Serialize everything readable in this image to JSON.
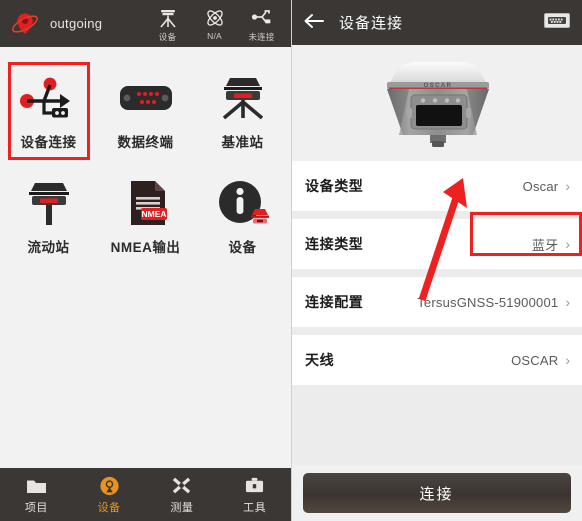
{
  "left": {
    "header": {
      "logo_icon": "red-location-planet-logo",
      "app_name": "outgoing",
      "status": [
        {
          "icon": "antenna-tripod-icon",
          "label": "设备"
        },
        {
          "icon": "satellite-atom-icon",
          "label": "N/A"
        },
        {
          "icon": "usb-plug-icon",
          "label": "未连接"
        }
      ]
    },
    "grid": [
      {
        "icon": "usb-connect-icon",
        "label": "设备连接",
        "selected": true
      },
      {
        "icon": "serial-port-icon",
        "label": "数据终端",
        "selected": false
      },
      {
        "icon": "base-station-icon",
        "label": "基准站",
        "selected": false
      },
      {
        "icon": "rover-station-icon",
        "label": "流动站",
        "selected": false
      },
      {
        "icon": "nmea-file-icon",
        "label": "NMEA输出",
        "selected": false
      },
      {
        "icon": "device-info-icon",
        "label": "设备",
        "selected": false
      }
    ],
    "tabbar": [
      {
        "icon": "folder-icon",
        "label": "项目",
        "active": false
      },
      {
        "icon": "device-radar-icon",
        "label": "设备",
        "active": true
      },
      {
        "icon": "survey-cross-icon",
        "label": "测量",
        "active": false
      },
      {
        "icon": "toolbox-icon",
        "label": "工具",
        "active": false
      }
    ],
    "highlight_color": "#ee2020"
  },
  "right": {
    "header": {
      "back_icon": "back-arrow-icon",
      "title": "设备连接",
      "right_icon": "serial-connector-icon"
    },
    "device_image": {
      "icon": "gnss-receiver-image",
      "brand_text": "OSCAR"
    },
    "rows": [
      {
        "label": "设备类型",
        "value": "Oscar",
        "highlighted": false
      },
      {
        "label": "连接类型",
        "value": "蓝牙",
        "highlighted": true
      },
      {
        "label": "连接配置",
        "value": "TersusGNSS-51900001",
        "highlighted": false
      },
      {
        "label": "天线",
        "value": "OSCAR",
        "highlighted": false
      }
    ],
    "connect_button": "连接",
    "annotation": {
      "arrow_icon": "red-pointer-arrow",
      "color": "#ee2020"
    }
  },
  "colors": {
    "header_bg": "#3b3734",
    "accent": "#e8931e",
    "highlight": "#ee2020",
    "panel_bg": "#f1f1f1",
    "row_bg": "#ffffff"
  }
}
